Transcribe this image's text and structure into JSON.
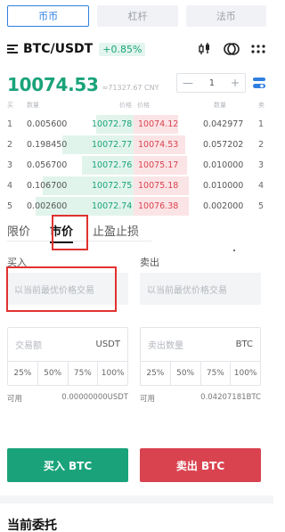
{
  "tabs": [
    {
      "label": "币币",
      "active": true
    },
    {
      "label": "杠杆",
      "active": false
    },
    {
      "label": "法币",
      "active": false
    }
  ],
  "header": {
    "pair": "BTC/USDT",
    "change": "+0.85%",
    "icons": [
      "candlestick-chart-icon",
      "exchange-circle-icon",
      "more-dots-icon"
    ]
  },
  "price": {
    "last": "10074.53",
    "cny": "≈71327.67 CNY",
    "depth": "1",
    "minus": "—",
    "plus": "+"
  },
  "orderbook": {
    "headers": {
      "buy_idx": "买",
      "buy_qty": "数量",
      "buy_price": "价格",
      "sell_price": "价格",
      "sell_qty": "数量",
      "sell_idx": "卖"
    },
    "rows": [
      {
        "idx": "1",
        "bid_qty": "0.005600",
        "bid_price": "10072.78",
        "ask_price": "10074.12",
        "ask_qty": "0.042977",
        "ask_idx": "1"
      },
      {
        "idx": "2",
        "bid_qty": "0.198450",
        "bid_price": "10072.77",
        "ask_price": "10074.53",
        "ask_qty": "0.057202",
        "ask_idx": "2"
      },
      {
        "idx": "3",
        "bid_qty": "0.056700",
        "bid_price": "10072.76",
        "ask_price": "10075.17",
        "ask_qty": "0.010000",
        "ask_idx": "3"
      },
      {
        "idx": "4",
        "bid_qty": "0.106700",
        "bid_price": "10072.75",
        "ask_price": "10075.18",
        "ask_qty": "0.010000",
        "ask_idx": "4"
      },
      {
        "idx": "5",
        "bid_qty": "0.002600",
        "bid_price": "10072.74",
        "ask_price": "10076.38",
        "ask_qty": "0.002000",
        "ask_idx": "5"
      }
    ]
  },
  "order_types": [
    {
      "label": "限价",
      "active": false
    },
    {
      "label": "市价",
      "active": true
    },
    {
      "label": "止盈止损",
      "active": false
    }
  ],
  "buy": {
    "label": "买入",
    "price_placeholder": "以当前最优价格交易",
    "amount_placeholder": "交易额",
    "amount_unit": "USDT",
    "avail_label": "可用",
    "avail_value": "0.00000000USDT",
    "button": "买入 BTC"
  },
  "sell": {
    "label": "卖出",
    "price_placeholder": "以当前最优价格交易",
    "amount_placeholder": "卖出数量",
    "amount_unit": "BTC",
    "avail_label": "可用",
    "avail_value": "0.04207181BTC",
    "button": "卖出 BTC"
  },
  "percents": [
    "25%",
    "50%",
    "75%",
    "100%"
  ],
  "section_title": "当前委托",
  "colors": {
    "green": "#1aa37a",
    "red": "#d9434f",
    "blue": "#2f7fe0",
    "highlight": "#e0322f"
  }
}
